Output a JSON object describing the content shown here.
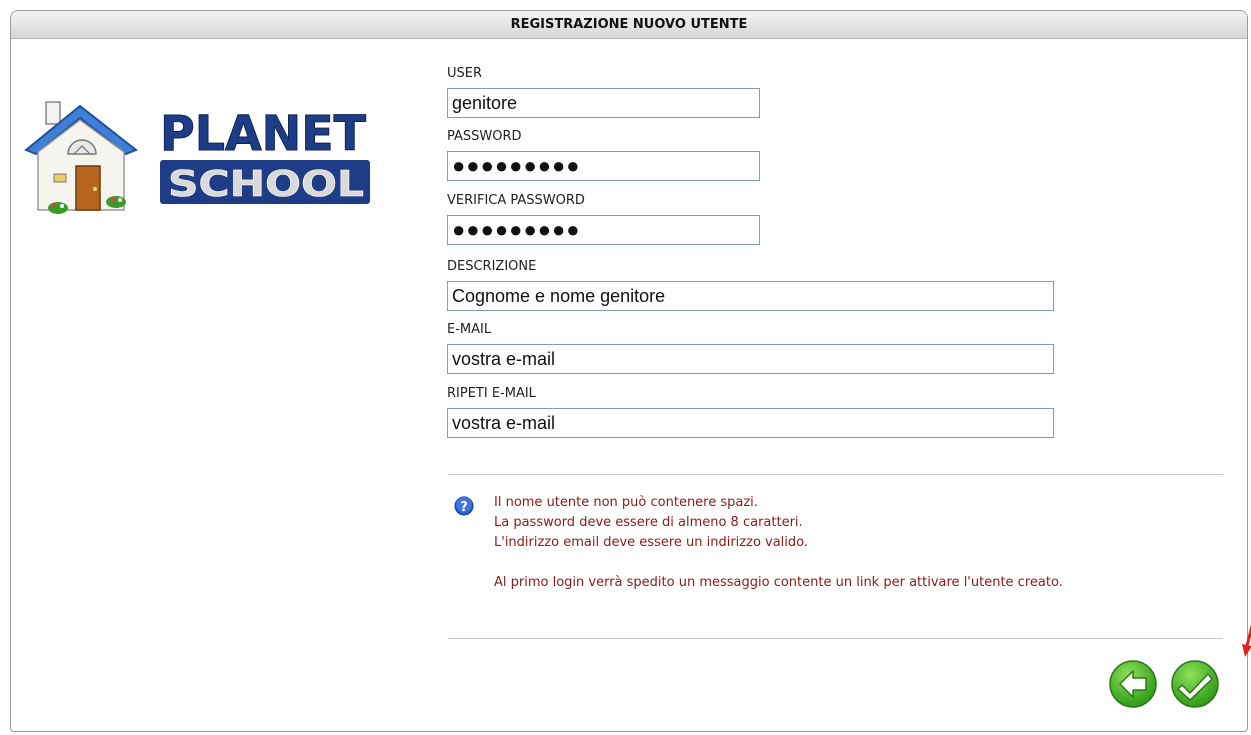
{
  "header": {
    "title": "REGISTRAZIONE NUOVO UTENTE"
  },
  "logo": {
    "line1": "PLANET",
    "line2": "SCHOOL"
  },
  "form": {
    "user": {
      "label": "USER",
      "value": "genitore"
    },
    "password": {
      "label": "PASSWORD",
      "value": "●●●●●●●●●"
    },
    "verify_password": {
      "label": "VERIFICA PASSWORD",
      "value": "●●●●●●●●●"
    },
    "description": {
      "label": "DESCRIZIONE",
      "value": "Cognome e nome genitore"
    },
    "email": {
      "label": "E-MAIL",
      "value": "vostra e-mail"
    },
    "repeat_email": {
      "label": "RIPETI E-MAIL",
      "value": "vostra e-mail"
    }
  },
  "help": {
    "line1": "Il nome utente non può contenere spazi.",
    "line2": "La password deve essere di almeno 8 caratteri.",
    "line3": "L'indirizzo email deve essere un indirizzo valido.",
    "line4": "Al primo login verrà spedito un messaggio contente un link per attivare l'utente creato."
  },
  "colors": {
    "help_text": "#8b1a1a",
    "button_green": "#3aa81f",
    "annotation_arrow": "#e0241b"
  }
}
